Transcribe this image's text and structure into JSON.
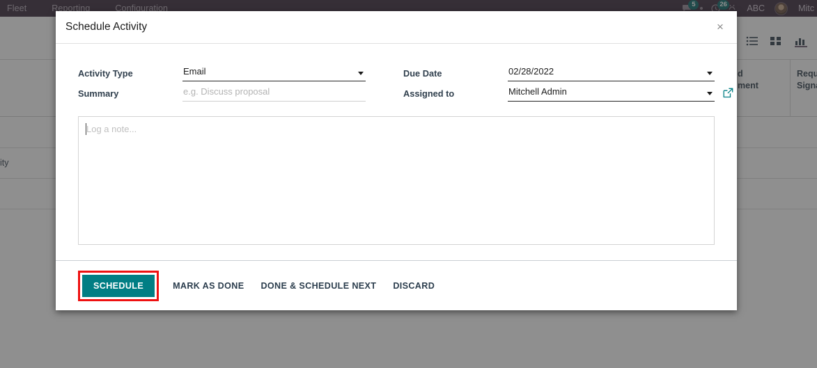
{
  "navbar": {
    "menu_items": [
      {
        "label": "Fleet"
      },
      {
        "label": "Reporting"
      },
      {
        "label": "Configuration"
      }
    ],
    "messages_badge": "5",
    "activities_badge": "26",
    "company": "ABC",
    "user": "Mitc",
    "icons": {
      "messages": "chat-bubble-icon",
      "dot": "dot-icon",
      "activities": "clock-icon",
      "debug": "bug-icon",
      "avatar": "user-avatar"
    }
  },
  "background": {
    "view_switcher": [
      {
        "name": "list-view-icon",
        "active": false
      },
      {
        "name": "kanban-view-icon",
        "active": false
      },
      {
        "name": "graph-view-icon",
        "active": true
      }
    ],
    "column_headers": [
      {
        "text_line1": "d",
        "text_line2": "ment"
      },
      {
        "text_line1": "Requ",
        "text_line2": "Signa"
      }
    ],
    "row_text": "ity"
  },
  "modal": {
    "title": "Schedule Activity",
    "close_icon": "×",
    "fields": {
      "activity_type": {
        "label": "Activity Type",
        "value": "Email",
        "placeholder": ""
      },
      "summary": {
        "label": "Summary",
        "value": "",
        "placeholder": "e.g. Discuss proposal"
      },
      "due_date": {
        "label": "Due Date",
        "value": "02/28/2022",
        "placeholder": ""
      },
      "assigned_to": {
        "label": "Assigned to",
        "value": "Mitchell Admin",
        "placeholder": "",
        "external_link_icon": "external-link-icon"
      }
    },
    "note": {
      "placeholder": "Log a note..."
    },
    "footer": {
      "schedule": "SCHEDULE",
      "mark_as_done": "MARK AS DONE",
      "done_schedule_next": "DONE & SCHEDULE NEXT",
      "discard": "DISCARD"
    }
  },
  "colors": {
    "primary": "#017e84",
    "highlight": "#ee1111",
    "navbar": "#3b2c3d",
    "badge": "#0c6b6b"
  }
}
